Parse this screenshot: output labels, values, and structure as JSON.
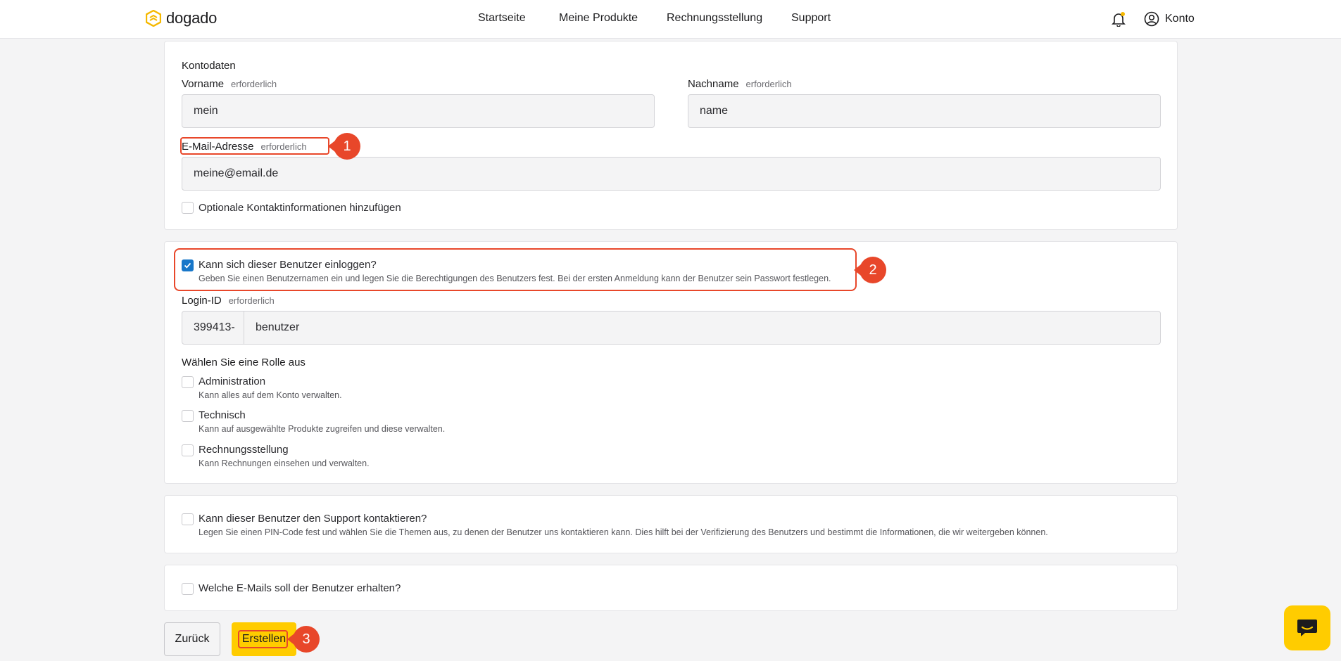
{
  "header": {
    "logo_text": "dogado",
    "nav": [
      "Startseite",
      "Meine Produkte",
      "Rechnungsstellung",
      "Support"
    ],
    "account_label": "Konto",
    "accent": "#ffcc00"
  },
  "account_card": {
    "title": "Kontodaten",
    "firstname_label": "Vorname",
    "firstname_req": "erforderlich",
    "firstname_value": "mein",
    "lastname_label": "Nachname",
    "lastname_req": "erforderlich",
    "lastname_value": "name",
    "email_label": "E-Mail-Adresse",
    "email_req": "erforderlich",
    "email_value": "meine@email.de",
    "optional_contact_label": "Optionale Kontaktinformationen hinzufügen"
  },
  "login_card": {
    "can_login_label": "Kann sich dieser Benutzer einloggen?",
    "can_login_desc": "Geben Sie einen Benutzernamen ein und legen Sie die Berechtigungen des Benutzers fest. Bei der ersten Anmeldung kann der Benutzer sein Passwort festlegen.",
    "login_id_label": "Login-ID",
    "login_id_req": "erforderlich",
    "login_prefix": "399413-",
    "login_value": "benutzer",
    "role_title": "Wählen Sie eine Rolle aus",
    "roles": [
      {
        "label": "Administration",
        "desc": "Kann alles auf dem Konto verwalten."
      },
      {
        "label": "Technisch",
        "desc": "Kann auf ausgewählte Produkte zugreifen und diese verwalten."
      },
      {
        "label": "Rechnungsstellung",
        "desc": "Kann Rechnungen einsehen und verwalten."
      }
    ]
  },
  "support_card": {
    "label": "Kann dieser Benutzer den Support kontaktieren?",
    "desc": "Legen Sie einen PIN-Code fest und wählen Sie die Themen aus, zu denen der Benutzer uns kontaktieren kann. Dies hilft bei der Verifizierung des Benutzers und bestimmt die Informationen, die wir weitergeben können."
  },
  "emails_card": {
    "label": "Welche E-Mails soll der Benutzer erhalten?"
  },
  "actions": {
    "back_label": "Zurück",
    "create_label": "Erstellen"
  },
  "annotations": [
    "1",
    "2",
    "3"
  ]
}
